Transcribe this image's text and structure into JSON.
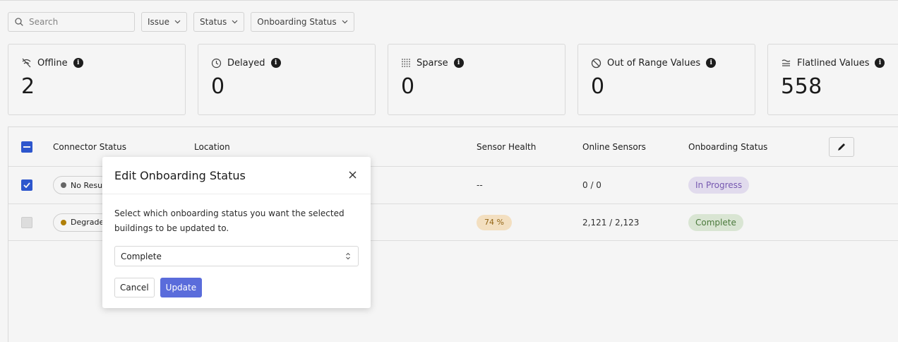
{
  "filters": {
    "search_placeholder": "Search",
    "issue_label": "Issue",
    "status_label": "Status",
    "onboarding_label": "Onboarding Status"
  },
  "cards": [
    {
      "label": "Offline",
      "value": "2",
      "icon": "wifi-off-icon"
    },
    {
      "label": "Delayed",
      "value": "0",
      "icon": "clock-icon"
    },
    {
      "label": "Sparse",
      "value": "0",
      "icon": "dotted-grid-icon"
    },
    {
      "label": "Out of Range Values",
      "value": "0",
      "icon": "prohibited-icon"
    },
    {
      "label": "Flatlined Values",
      "value": "558",
      "icon": "approx-equal-icon"
    }
  ],
  "table": {
    "headers": {
      "connector_status": "Connector Status",
      "location": "Location",
      "sensor_health": "Sensor Health",
      "online_sensors": "Online Sensors",
      "onboarding_status": "Onboarding Status"
    },
    "rows": [
      {
        "checked": true,
        "connector_status": "No Resu",
        "connector_dot_color": "#6b6b6b",
        "sensor_health": "--",
        "online_sensors": "0 / 0",
        "onboarding_status": "In Progress",
        "onboarding_bg": "#ebe4f7",
        "onboarding_fg": "#7b5cb8"
      },
      {
        "checked": false,
        "connector_status": "Degrade",
        "connector_dot_color": "#b8860b",
        "sensor_health": "74 %",
        "online_sensors": "2,121 / 2,123",
        "onboarding_status": "Complete",
        "onboarding_bg": "#e2efdc",
        "onboarding_fg": "#4f7f3f"
      }
    ]
  },
  "modal": {
    "title": "Edit Onboarding Status",
    "description": "Select which onboarding status you want the selected buildings to be updated to.",
    "select_value": "Complete",
    "cancel_label": "Cancel",
    "update_label": "Update"
  },
  "colors": {
    "accent": "#2f5ad6",
    "update_button": "#5a6cdb"
  }
}
